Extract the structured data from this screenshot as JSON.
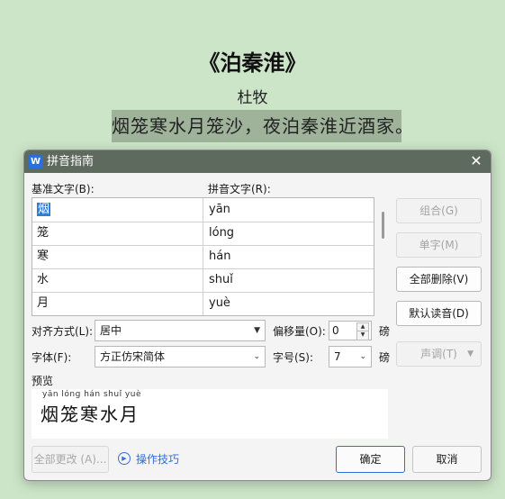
{
  "document": {
    "title": "《泊秦淮》",
    "author": "杜牧",
    "selected_line": "烟笼寒水月笼沙，夜泊秦淮近酒家。"
  },
  "dialog": {
    "title": "拼音指南",
    "app_icon_letter": "W",
    "base_text_label": "基准文字(B):",
    "pinyin_text_label": "拼音文字(R):",
    "rows": [
      {
        "base": "烟",
        "pinyin": "yān",
        "selected": true
      },
      {
        "base": "笼",
        "pinyin": "lóng"
      },
      {
        "base": "寒",
        "pinyin": "hán"
      },
      {
        "base": "水",
        "pinyin": "shuǐ"
      },
      {
        "base": "月",
        "pinyin": "yuè"
      }
    ],
    "buttons": {
      "group": "组合(G)",
      "single": "单字(M)",
      "delete_all": "全部删除(V)",
      "default_reading": "默认读音(D)",
      "tone": "声调(T)",
      "change_all": "全部更改 (A)...",
      "ok": "确定",
      "cancel": "取消"
    },
    "alignment_label": "对齐方式(L):",
    "alignment_value": "居中",
    "offset_label": "偏移量(O):",
    "offset_value": "0",
    "offset_unit": "磅",
    "font_label": "字体(F):",
    "font_value": "方正仿宋简体",
    "size_label": "字号(S):",
    "size_value": "7",
    "size_unit": "磅",
    "preview_label": "预览",
    "preview_pinyin": "yān lóng hán shuǐ yuè",
    "preview_text": "烟笼寒水月",
    "tips_label": "操作技巧"
  }
}
